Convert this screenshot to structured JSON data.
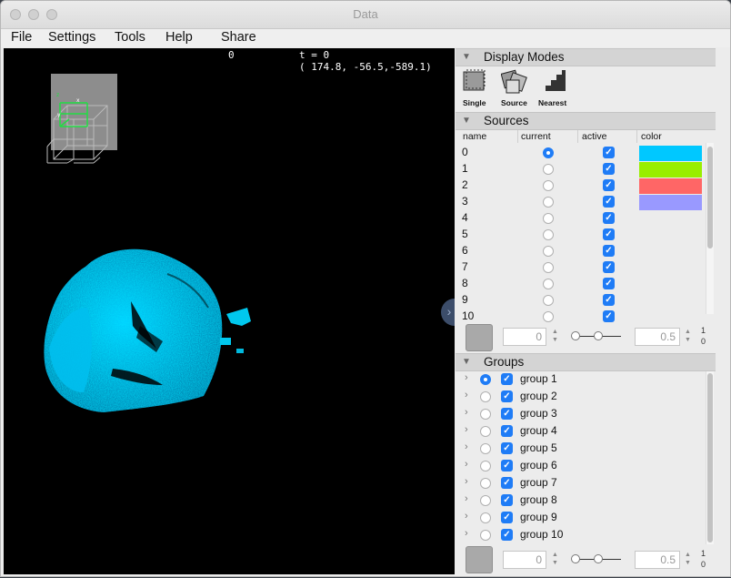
{
  "window": {
    "title": "Data"
  },
  "menu": [
    "File",
    "Settings",
    "Tools",
    "Help",
    "Share"
  ],
  "viewer": {
    "frame": "0",
    "time": "t = 0",
    "coords": "( 174.8, -56.5,-589.1)"
  },
  "display_modes": {
    "header": "Display Modes",
    "modes": [
      {
        "label": "Single",
        "icon": "single-mode-icon"
      },
      {
        "label": "Source",
        "icon": "source-mode-icon"
      },
      {
        "label": "Nearest",
        "icon": "nearest-mode-icon"
      }
    ]
  },
  "sources": {
    "header": "Sources",
    "columns": [
      "name",
      "current",
      "active",
      "color"
    ],
    "rows": [
      {
        "name": "0",
        "current": true,
        "active": true,
        "color": "#00c8ff"
      },
      {
        "name": "1",
        "current": false,
        "active": true,
        "color": "#99ee00"
      },
      {
        "name": "2",
        "current": false,
        "active": true,
        "color": "#ff6666"
      },
      {
        "name": "3",
        "current": false,
        "active": true,
        "color": "#9999ff"
      },
      {
        "name": "4",
        "current": false,
        "active": true,
        "color": ""
      },
      {
        "name": "5",
        "current": false,
        "active": true,
        "color": ""
      },
      {
        "name": "6",
        "current": false,
        "active": true,
        "color": ""
      },
      {
        "name": "7",
        "current": false,
        "active": true,
        "color": ""
      },
      {
        "name": "8",
        "current": false,
        "active": true,
        "color": ""
      },
      {
        "name": "9",
        "current": false,
        "active": true,
        "color": ""
      },
      {
        "name": "10",
        "current": false,
        "active": true,
        "color": ""
      }
    ],
    "controls": {
      "min": "0",
      "gamma": "0.5",
      "range_top": "1",
      "range_bottom": "0"
    }
  },
  "groups": {
    "header": "Groups",
    "rows": [
      {
        "label": "group 1",
        "current": true,
        "active": true
      },
      {
        "label": "group 2",
        "current": false,
        "active": true
      },
      {
        "label": "group 3",
        "current": false,
        "active": true
      },
      {
        "label": "group 4",
        "current": false,
        "active": true
      },
      {
        "label": "group 5",
        "current": false,
        "active": true
      },
      {
        "label": "group 6",
        "current": false,
        "active": true
      },
      {
        "label": "group 7",
        "current": false,
        "active": true
      },
      {
        "label": "group 8",
        "current": false,
        "active": true
      },
      {
        "label": "group 9",
        "current": false,
        "active": true
      },
      {
        "label": "group 10",
        "current": false,
        "active": true
      }
    ],
    "controls": {
      "min": "0",
      "gamma": "0.5",
      "range_top": "1",
      "range_bottom": "0"
    }
  }
}
